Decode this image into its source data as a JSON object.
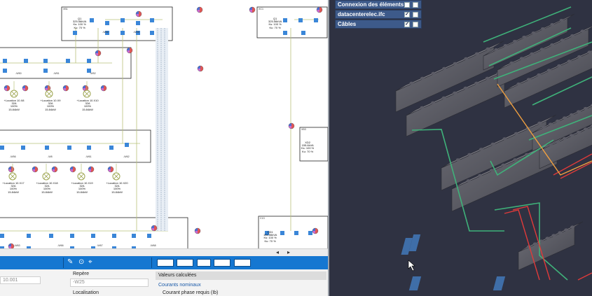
{
  "schematic": {
    "boxes": [
      {
        "id": "box-top",
        "title": "XB1"
      },
      {
        "id": "box-right",
        "title": "XC1"
      }
    ],
    "top_node": {
      "name": "Q1",
      "lines": [
        "325.56kVA",
        "Ks: 100 %",
        "Ku: 70 %"
      ]
    },
    "right_node": {
      "name": "Q1",
      "lines": [
        "325.56kVA",
        "Ks: 100 %",
        "Ku: 70 %"
      ]
    },
    "right_node2": {
      "name": "XD2",
      "lines": [
        "155.6kVA",
        "Ks: 100 %",
        "Ku: 70 %"
      ]
    },
    "right_node3": {
      "name": "QD1",
      "lines": [
        "155.56kVA",
        "Ks: 100 %",
        "Ku: 70 %"
      ]
    },
    "feeders_top": [
      "-W46",
      "-W25"
    ],
    "row1_loads": [
      {
        "name": "+Location 10.X8",
        "lines": [
          "32A",
          "100%",
          "15.84kW"
        ]
      },
      {
        "name": "+Location 10.X9",
        "lines": [
          "32A",
          "100%",
          "15.84kW"
        ]
      },
      {
        "name": "+Location 10.X10",
        "lines": [
          "32A",
          "100%",
          "15.84kW"
        ]
      }
    ],
    "row2_loads": [
      {
        "name": "+Location 10.X17",
        "lines": [
          "32A",
          "100%",
          "15.84kW"
        ]
      },
      {
        "name": "+Location 10.X18",
        "lines": [
          "32A",
          "100%",
          "15.84kW"
        ]
      },
      {
        "name": "+Location 10.X19",
        "lines": [
          "32A",
          "100%",
          "15.84kW"
        ]
      },
      {
        "name": "+Location 10.X20",
        "lines": [
          "32A",
          "100%",
          "15.84kW"
        ]
      }
    ],
    "row1_cables": [
      "-W50",
      "-W51",
      "-W52"
    ],
    "row2_cables": [
      "-W56",
      "-W8",
      "-W61",
      "-W62"
    ],
    "row3_cables": [
      "-W63",
      "-W66",
      "-W67",
      "-W68"
    ],
    "box_labels": [
      "X50",
      "C5",
      "C6",
      "C7",
      "C8",
      "C10",
      "XB3",
      "C13",
      "C12"
    ],
    "scroll_arrow": "◂",
    "scroll_arrow_r": "▸"
  },
  "layers": [
    {
      "label": "Connexion des éléments",
      "visible": false,
      "locked": false
    },
    {
      "label": "datacenterelec.ifc",
      "visible": true,
      "locked": false
    },
    {
      "label": "Câbles",
      "visible": true,
      "locked": false
    }
  ],
  "properties": {
    "repere_label": "Repère",
    "repere_value": "-W25",
    "localisation_label": "Localisation",
    "left_value": "10.001",
    "computed_head": "Valeurs calculées",
    "nominal_sub": "Courants nominaux",
    "phase_item": "Courant phase requis (Ib)"
  },
  "colors": {
    "toolbar": "#1577d1",
    "view_bg": "#2f3242",
    "layer_bg": "#3d5a8a"
  }
}
